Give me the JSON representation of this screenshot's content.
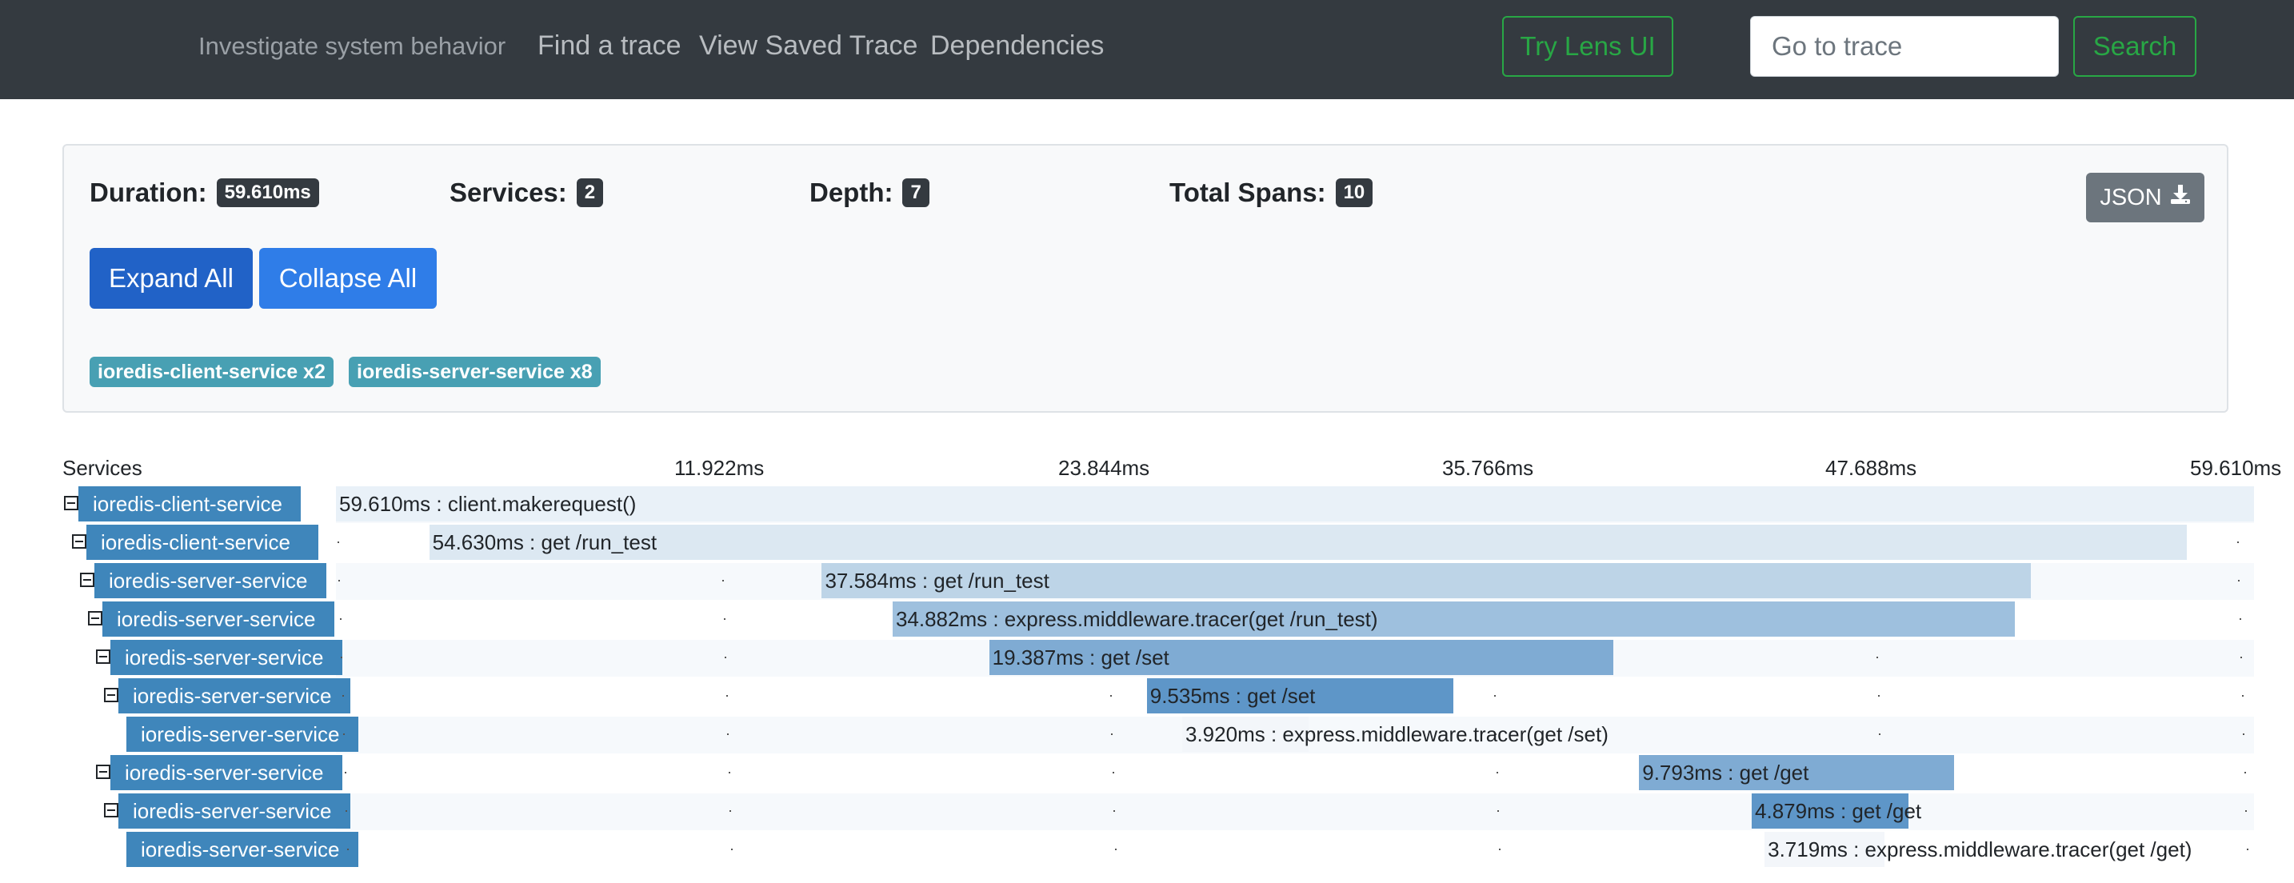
{
  "navbar": {
    "tagline": "Investigate system behavior",
    "links": [
      "Find a trace",
      "View Saved Trace",
      "Dependencies"
    ],
    "lens_button": "Try Lens UI",
    "trace_input_placeholder": "Go to trace",
    "search_button": "Search"
  },
  "summary": {
    "duration_label": "Duration:",
    "duration_value": "59.610ms",
    "services_label": "Services:",
    "services_value": "2",
    "depth_label": "Depth:",
    "depth_value": "7",
    "total_spans_label": "Total Spans:",
    "total_spans_value": "10",
    "json_button": "JSON",
    "expand_all": "Expand All",
    "collapse_all": "Collapse All",
    "service_badges": [
      "ioredis-client-service x2",
      "ioredis-server-service x8"
    ]
  },
  "timeline": {
    "services_header": "Services",
    "tick_labels": [
      "11.922ms",
      "23.844ms",
      "35.766ms",
      "47.688ms",
      "59.610ms"
    ],
    "total_ms": 59.61,
    "spans": [
      {
        "service": "ioredis-client-service",
        "label": "59.610ms : client.makerequest()",
        "start_ms": 0,
        "duration_ms": 59.61,
        "depth": 0,
        "collapsible": true,
        "color": "#e9f1f8"
      },
      {
        "service": "ioredis-client-service",
        "label": "54.630ms : get /run_test",
        "start_ms": 2.9,
        "duration_ms": 54.63,
        "depth": 1,
        "collapsible": true,
        "color": "#dce8f2"
      },
      {
        "service": "ioredis-server-service",
        "label": "37.584ms : get /run_test",
        "start_ms": 15.1,
        "duration_ms": 37.584,
        "depth": 2,
        "collapsible": true,
        "color": "#bdd4e7"
      },
      {
        "service": "ioredis-server-service",
        "label": "34.882ms : express.middleware.tracer(get /run_test)",
        "start_ms": 17.3,
        "duration_ms": 34.882,
        "depth": 3,
        "collapsible": true,
        "color": "#9ec0de"
      },
      {
        "service": "ioredis-server-service",
        "label": "19.387ms : get /set",
        "start_ms": 20.3,
        "duration_ms": 19.387,
        "depth": 4,
        "collapsible": true,
        "color": "#7fabd3"
      },
      {
        "service": "ioredis-server-service",
        "label": "9.535ms : get /set",
        "start_ms": 25.2,
        "duration_ms": 9.535,
        "depth": 5,
        "collapsible": true,
        "color": "#5e96c8"
      },
      {
        "service": "ioredis-server-service",
        "label": "3.920ms : express.middleware.tracer(get /set)",
        "start_ms": 26.3,
        "duration_ms": 3.92,
        "depth": 6,
        "collapsible": false,
        "color": "#f3f6fa"
      },
      {
        "service": "ioredis-server-service",
        "label": "9.793ms : get /get",
        "start_ms": 40.5,
        "duration_ms": 9.793,
        "depth": 4,
        "collapsible": true,
        "color": "#7fabd3"
      },
      {
        "service": "ioredis-server-service",
        "label": "4.879ms : get /get",
        "start_ms": 44.0,
        "duration_ms": 4.879,
        "depth": 5,
        "collapsible": true,
        "color": "#5e96c8"
      },
      {
        "service": "ioredis-server-service",
        "label": "3.719ms : express.middleware.tracer(get /get)",
        "start_ms": 44.4,
        "duration_ms": 3.719,
        "depth": 6,
        "collapsible": false,
        "color": "#f3f6fa"
      }
    ]
  },
  "colors": {
    "navbar": "#343a40",
    "accent_green": "#28a745",
    "expand_button": "#2162c7",
    "collapse_button": "#2f7de8",
    "service_badge": "#48a0b3",
    "service_label": "#3f86bb"
  }
}
